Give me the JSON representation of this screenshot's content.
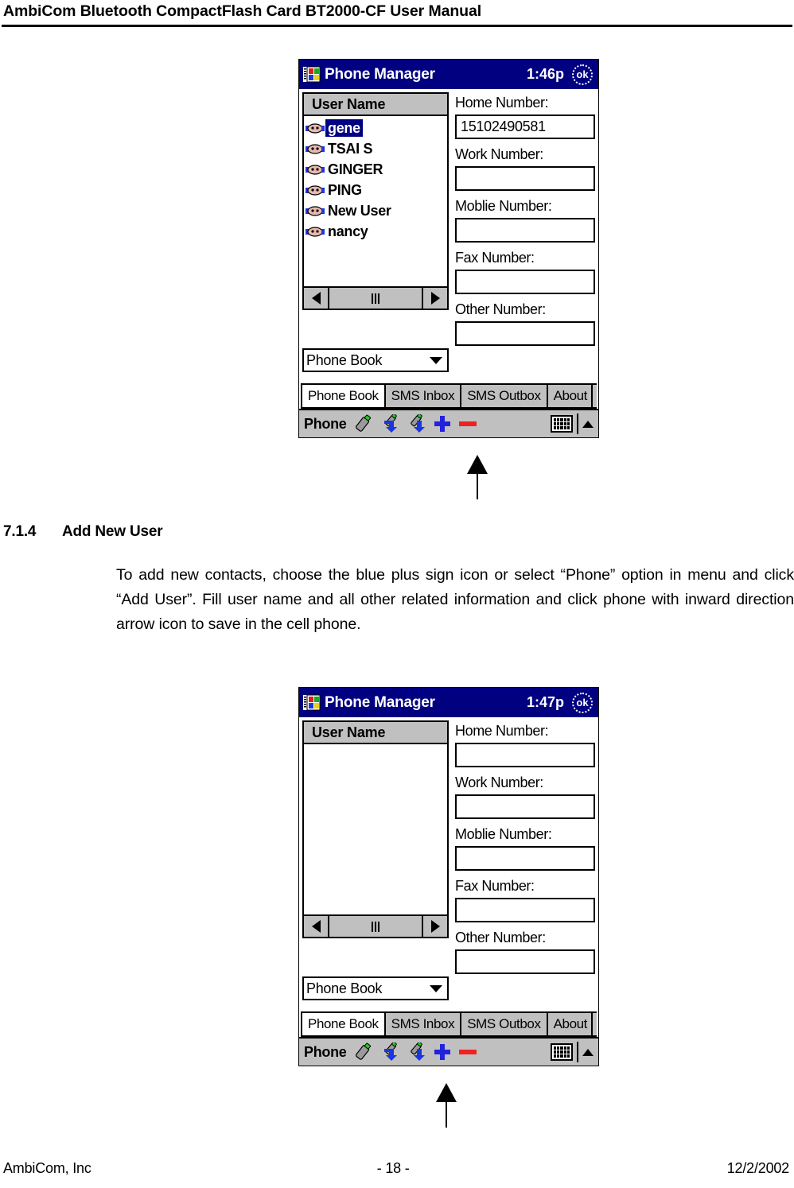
{
  "header": {
    "title": "AmbiCom Bluetooth CompactFlash Card BT2000-CF User Manual"
  },
  "section": {
    "number": "7.1.4",
    "heading": "Add New User",
    "body": "To add new contacts, choose the blue plus sign icon or select  “Phone” option in menu and click “Add User”. Fill user name and all other related information and click phone with inward direction arrow icon to save in the cell phone."
  },
  "screenshot1": {
    "titlebar": {
      "app_icon": "phone-manager-book-icon",
      "title": "Phone Manager",
      "time": "1:46p",
      "ok_label": "ok"
    },
    "list": {
      "header": "User Name",
      "items": [
        {
          "label": "gene",
          "selected": true
        },
        {
          "label": "TSAI S",
          "selected": false
        },
        {
          "label": "GINGER",
          "selected": false
        },
        {
          "label": "PING",
          "selected": false
        },
        {
          "label": "New User",
          "selected": false
        },
        {
          "label": "nancy",
          "selected": false
        }
      ]
    },
    "combo": {
      "value": "Phone Book"
    },
    "fields": [
      {
        "label": "Home Number:",
        "value": "15102490581"
      },
      {
        "label": "Work Number:",
        "value": ""
      },
      {
        "label": "Moblie Number:",
        "value": ""
      },
      {
        "label": "Fax Number:",
        "value": ""
      },
      {
        "label": "Other Number:",
        "value": ""
      }
    ],
    "tabs": [
      {
        "label": "Phone Book",
        "active": true
      },
      {
        "label": "SMS Inbox",
        "active": false
      },
      {
        "label": "SMS Outbox",
        "active": false
      },
      {
        "label": "About",
        "active": false
      }
    ],
    "commandbar": {
      "menu": "Phone",
      "icons": [
        "phone-icon",
        "phone-receive-arrow-icon",
        "phone-send-arrow-icon",
        "add-plus-icon",
        "delete-minus-icon"
      ],
      "keyboard_icon": "keyboard-icon",
      "keyboard_chevron": "chevron-up-icon"
    }
  },
  "screenshot2": {
    "titlebar": {
      "app_icon": "phone-manager-book-icon",
      "title": "Phone Manager",
      "time": "1:47p",
      "ok_label": "ok"
    },
    "list": {
      "header": "User Name",
      "items": []
    },
    "combo": {
      "value": "Phone Book"
    },
    "fields": [
      {
        "label": "Home Number:",
        "value": ""
      },
      {
        "label": "Work Number:",
        "value": ""
      },
      {
        "label": "Moblie Number:",
        "value": ""
      },
      {
        "label": "Fax Number:",
        "value": ""
      },
      {
        "label": "Other Number:",
        "value": ""
      }
    ],
    "tabs": [
      {
        "label": "Phone Book",
        "active": true
      },
      {
        "label": "SMS Inbox",
        "active": false
      },
      {
        "label": "SMS Outbox",
        "active": false
      },
      {
        "label": "About",
        "active": false
      }
    ],
    "commandbar": {
      "menu": "Phone",
      "icons": [
        "phone-icon",
        "phone-receive-arrow-icon",
        "phone-send-arrow-icon",
        "add-plus-icon",
        "delete-minus-icon"
      ],
      "keyboard_icon": "keyboard-icon",
      "keyboard_chevron": "chevron-up-icon"
    }
  },
  "footer": {
    "left": "AmbiCom, Inc",
    "center": "- 18 -",
    "right": "12/2/2002"
  },
  "colors": {
    "titlebar": "#000080",
    "selection": "#000080",
    "chrome": "#c0c0c0",
    "plus": "#2222dd",
    "minus": "#ee2222"
  }
}
